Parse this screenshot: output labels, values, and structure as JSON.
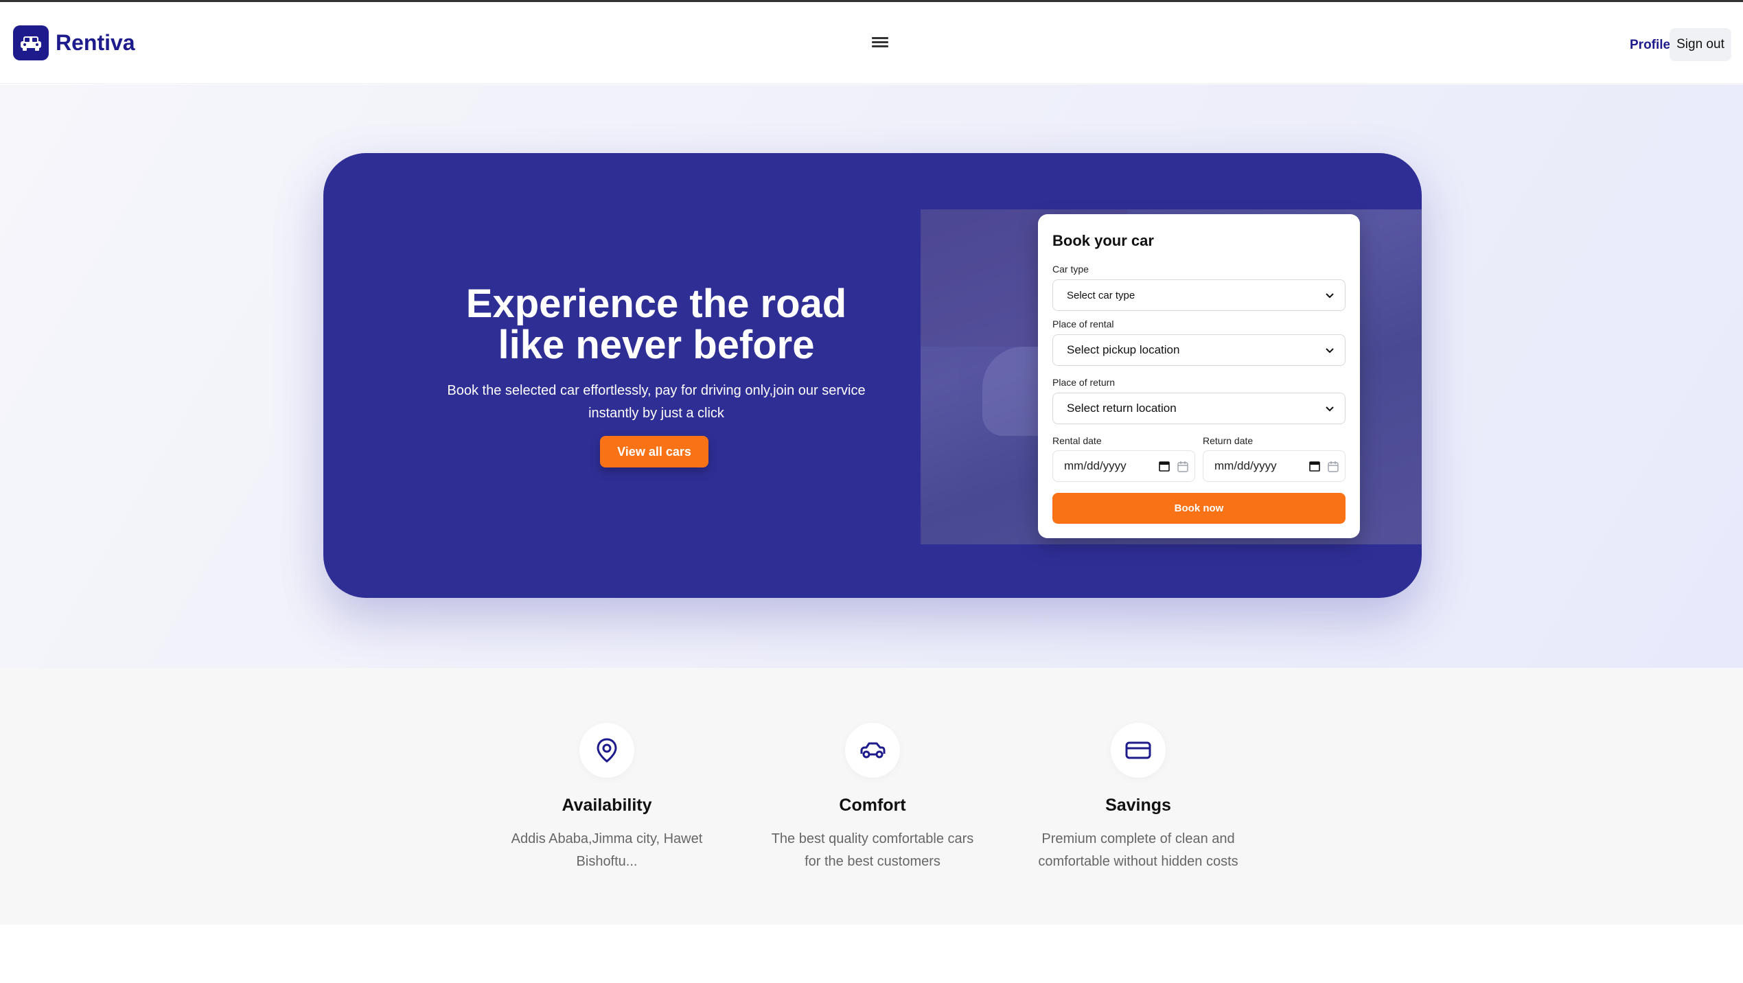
{
  "app": {
    "name": "Rentiva",
    "accent_color": "#1e1b8c",
    "cta_color": "#f97316",
    "hero_color": "#2f2e95"
  },
  "nav": {
    "profile_label": "Profile",
    "signout_label": "Sign out",
    "menu_icon": "hamburger-icon"
  },
  "hero": {
    "title": "Experience the road like never before",
    "subtitle": "Book the selected car effortlessly, pay for driving only,join our service instantly by just a click",
    "cta_label": "View all cars"
  },
  "booking": {
    "title": "Book your car",
    "car_type_label": "Car type",
    "car_type_value": "Select car type",
    "rental_place_label": "Place of rental",
    "rental_place_value": "Select pickup location",
    "return_place_label": "Place of return",
    "return_place_value": "Select return location",
    "rental_date_label": "Rental date",
    "rental_date_value": "mm/dd/yyyy",
    "return_date_label": "Return date",
    "return_date_value": "mm/dd/yyyy",
    "submit_label": "Book now"
  },
  "features": [
    {
      "icon": "location-pin-icon",
      "title": "Availability",
      "text": "Addis Ababa,Jimma city, Hawet Bishoftu..."
    },
    {
      "icon": "car-icon",
      "title": "Comfort",
      "text": "The best quality comfortable cars for the best customers"
    },
    {
      "icon": "credit-card-icon",
      "title": "Savings",
      "text": "Premium complete of clean and comfortable without hidden costs"
    }
  ]
}
